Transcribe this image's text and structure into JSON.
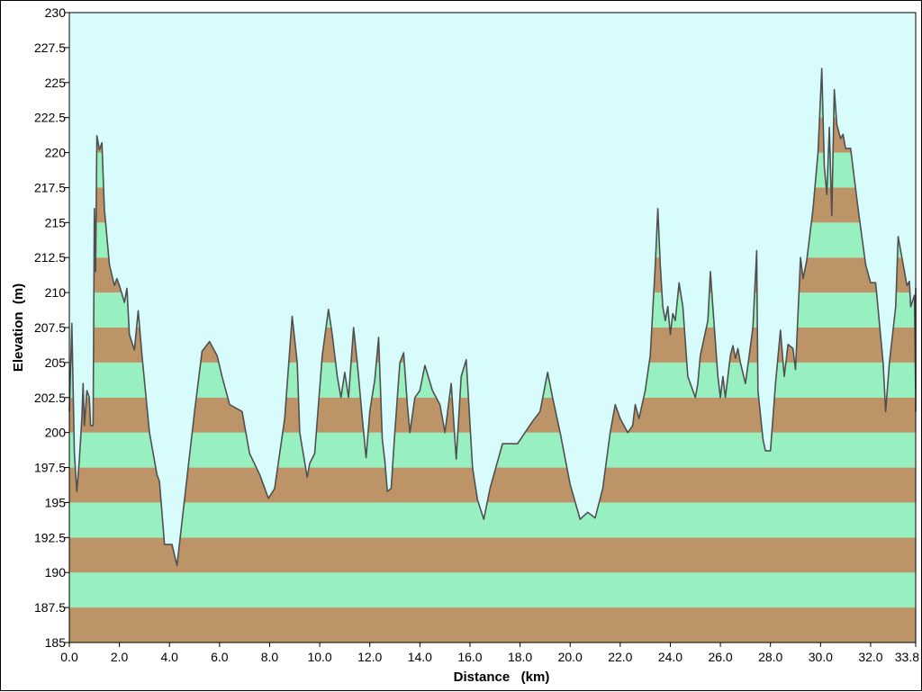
{
  "chart_data": {
    "type": "area",
    "title": "",
    "xlabel": "Distance   (km)",
    "ylabel": "Elevation  (m)",
    "xlim": [
      0.0,
      33.8
    ],
    "ylim": [
      185,
      230
    ],
    "x_ticks": [
      "0.0",
      "2.0",
      "4.0",
      "6.0",
      "8.0",
      "10.0",
      "12.0",
      "14.0",
      "16.0",
      "18.0",
      "20.0",
      "22.0",
      "24.0",
      "26.0",
      "28.0",
      "30.0",
      "32.0",
      "33.8"
    ],
    "y_ticks": [
      "185",
      "187.5",
      "190",
      "192.5",
      "195",
      "197.5",
      "200",
      "202.5",
      "205",
      "207.5",
      "210",
      "212.5",
      "215",
      "217.5",
      "220",
      "222.5",
      "225",
      "227.5",
      "230"
    ],
    "grid": false,
    "background_color": "#d8fcfc",
    "band_colors": [
      "#bc9468",
      "#98f0c0"
    ],
    "line_color": "#505050",
    "series": [
      {
        "points": [
          [
            0.0,
            201.5
          ],
          [
            0.1,
            207.8
          ],
          [
            0.2,
            198.5
          ],
          [
            0.3,
            195.8
          ],
          [
            0.4,
            198.0
          ],
          [
            0.5,
            201.0
          ],
          [
            0.55,
            203.5
          ],
          [
            0.6,
            200.5
          ],
          [
            0.7,
            203.0
          ],
          [
            0.8,
            202.5
          ],
          [
            0.85,
            200.5
          ],
          [
            0.95,
            200.5
          ],
          [
            1.0,
            216.0
          ],
          [
            1.05,
            211.5
          ],
          [
            1.1,
            221.2
          ],
          [
            1.2,
            220.2
          ],
          [
            1.3,
            220.7
          ],
          [
            1.4,
            216.0
          ],
          [
            1.6,
            212.0
          ],
          [
            1.8,
            210.5
          ],
          [
            1.9,
            211.0
          ],
          [
            2.0,
            210.5
          ],
          [
            2.2,
            209.3
          ],
          [
            2.3,
            210.3
          ],
          [
            2.4,
            207.0
          ],
          [
            2.6,
            205.9
          ],
          [
            2.75,
            208.7
          ],
          [
            2.9,
            205.5
          ],
          [
            3.2,
            200.0
          ],
          [
            3.5,
            197.0
          ],
          [
            3.6,
            196.5
          ],
          [
            3.8,
            192.0
          ],
          [
            4.1,
            192.0
          ],
          [
            4.3,
            190.5
          ],
          [
            4.6,
            195.2
          ],
          [
            5.0,
            201.5
          ],
          [
            5.3,
            205.8
          ],
          [
            5.6,
            206.5
          ],
          [
            5.9,
            205.5
          ],
          [
            6.1,
            204.0
          ],
          [
            6.4,
            202.0
          ],
          [
            6.9,
            201.5
          ],
          [
            7.2,
            198.5
          ],
          [
            7.6,
            197.0
          ],
          [
            7.95,
            195.3
          ],
          [
            8.2,
            196.0
          ],
          [
            8.6,
            201.0
          ],
          [
            8.9,
            208.3
          ],
          [
            9.1,
            205.0
          ],
          [
            9.2,
            200.0
          ],
          [
            9.5,
            196.8
          ],
          [
            9.6,
            197.8
          ],
          [
            9.8,
            198.5
          ],
          [
            10.1,
            205.5
          ],
          [
            10.35,
            208.8
          ],
          [
            10.5,
            207.0
          ],
          [
            10.7,
            204.0
          ],
          [
            10.85,
            202.5
          ],
          [
            11.0,
            204.3
          ],
          [
            11.15,
            202.5
          ],
          [
            11.35,
            207.5
          ],
          [
            11.5,
            205.0
          ],
          [
            11.7,
            201.0
          ],
          [
            11.85,
            198.2
          ],
          [
            12.0,
            201.5
          ],
          [
            12.2,
            203.8
          ],
          [
            12.35,
            206.8
          ],
          [
            12.5,
            199.5
          ],
          [
            12.6,
            198.0
          ],
          [
            12.7,
            195.8
          ],
          [
            12.85,
            196.0
          ],
          [
            13.0,
            200.0
          ],
          [
            13.2,
            205.0
          ],
          [
            13.35,
            205.7
          ],
          [
            13.5,
            202.0
          ],
          [
            13.6,
            200.0
          ],
          [
            13.8,
            202.5
          ],
          [
            14.0,
            203.0
          ],
          [
            14.2,
            204.8
          ],
          [
            14.5,
            203.0
          ],
          [
            14.8,
            202.0
          ],
          [
            15.0,
            200.0
          ],
          [
            15.25,
            203.5
          ],
          [
            15.45,
            198.1
          ],
          [
            15.65,
            204.0
          ],
          [
            15.85,
            205.2
          ],
          [
            16.1,
            197.5
          ],
          [
            16.3,
            195.2
          ],
          [
            16.55,
            193.8
          ],
          [
            16.8,
            196.0
          ],
          [
            17.3,
            199.2
          ],
          [
            17.9,
            199.2
          ],
          [
            18.5,
            200.8
          ],
          [
            18.8,
            201.5
          ],
          [
            19.1,
            204.3
          ],
          [
            19.3,
            202.5
          ],
          [
            19.6,
            200.0
          ],
          [
            20.0,
            196.3
          ],
          [
            20.4,
            193.8
          ],
          [
            20.7,
            194.3
          ],
          [
            21.0,
            193.9
          ],
          [
            21.3,
            196.0
          ],
          [
            21.6,
            200.0
          ],
          [
            21.8,
            202.0
          ],
          [
            22.0,
            201.0
          ],
          [
            22.3,
            200.0
          ],
          [
            22.5,
            200.5
          ],
          [
            22.6,
            202.0
          ],
          [
            22.75,
            201.0
          ],
          [
            23.0,
            203.0
          ],
          [
            23.2,
            205.5
          ],
          [
            23.4,
            212.0
          ],
          [
            23.5,
            216.0
          ],
          [
            23.6,
            212.0
          ],
          [
            23.7,
            209.0
          ],
          [
            23.8,
            208.0
          ],
          [
            23.9,
            209.0
          ],
          [
            24.0,
            207.0
          ],
          [
            24.1,
            208.5
          ],
          [
            24.2,
            208.0
          ],
          [
            24.35,
            210.7
          ],
          [
            24.5,
            209.0
          ],
          [
            24.7,
            204.0
          ],
          [
            25.0,
            202.5
          ],
          [
            25.1,
            203.5
          ],
          [
            25.2,
            205.5
          ],
          [
            25.5,
            208.0
          ],
          [
            25.6,
            211.5
          ],
          [
            25.7,
            209.0
          ],
          [
            25.9,
            204.0
          ],
          [
            26.0,
            202.5
          ],
          [
            26.1,
            204.0
          ],
          [
            26.2,
            202.5
          ],
          [
            26.4,
            205.5
          ],
          [
            26.5,
            206.2
          ],
          [
            26.6,
            205.3
          ],
          [
            26.7,
            206.0
          ],
          [
            26.8,
            205.0
          ],
          [
            27.0,
            203.5
          ],
          [
            27.15,
            205.5
          ],
          [
            27.3,
            207.5
          ],
          [
            27.45,
            213.0
          ],
          [
            27.5,
            203.0
          ],
          [
            27.7,
            199.5
          ],
          [
            27.8,
            198.7
          ],
          [
            28.0,
            198.7
          ],
          [
            28.2,
            203.5
          ],
          [
            28.4,
            207.3
          ],
          [
            28.55,
            204.0
          ],
          [
            28.7,
            206.3
          ],
          [
            28.9,
            206.0
          ],
          [
            29.0,
            204.5
          ],
          [
            29.2,
            212.5
          ],
          [
            29.3,
            211.0
          ],
          [
            29.45,
            212.3
          ],
          [
            29.7,
            216.0
          ],
          [
            29.9,
            220.0
          ],
          [
            30.05,
            226.0
          ],
          [
            30.15,
            219.0
          ],
          [
            30.25,
            217.0
          ],
          [
            30.35,
            221.8
          ],
          [
            30.45,
            215.5
          ],
          [
            30.55,
            224.5
          ],
          [
            30.65,
            222.0
          ],
          [
            30.8,
            221.0
          ],
          [
            30.9,
            221.3
          ],
          [
            31.0,
            220.3
          ],
          [
            31.2,
            220.3
          ],
          [
            31.5,
            216.0
          ],
          [
            31.8,
            212.0
          ],
          [
            32.0,
            210.7
          ],
          [
            32.2,
            210.7
          ],
          [
            32.5,
            205.0
          ],
          [
            32.6,
            201.5
          ],
          [
            32.75,
            205.0
          ],
          [
            33.0,
            209.0
          ],
          [
            33.1,
            214.0
          ],
          [
            33.3,
            212.0
          ],
          [
            33.45,
            210.5
          ],
          [
            33.55,
            210.8
          ],
          [
            33.6,
            209.0
          ],
          [
            33.75,
            209.8
          ],
          [
            33.85,
            202.5
          ],
          [
            33.95,
            201.5
          ],
          [
            34.05,
            205.0
          ],
          [
            34.15,
            210.3
          ],
          [
            34.2,
            209.5
          ]
        ]
      }
    ]
  }
}
